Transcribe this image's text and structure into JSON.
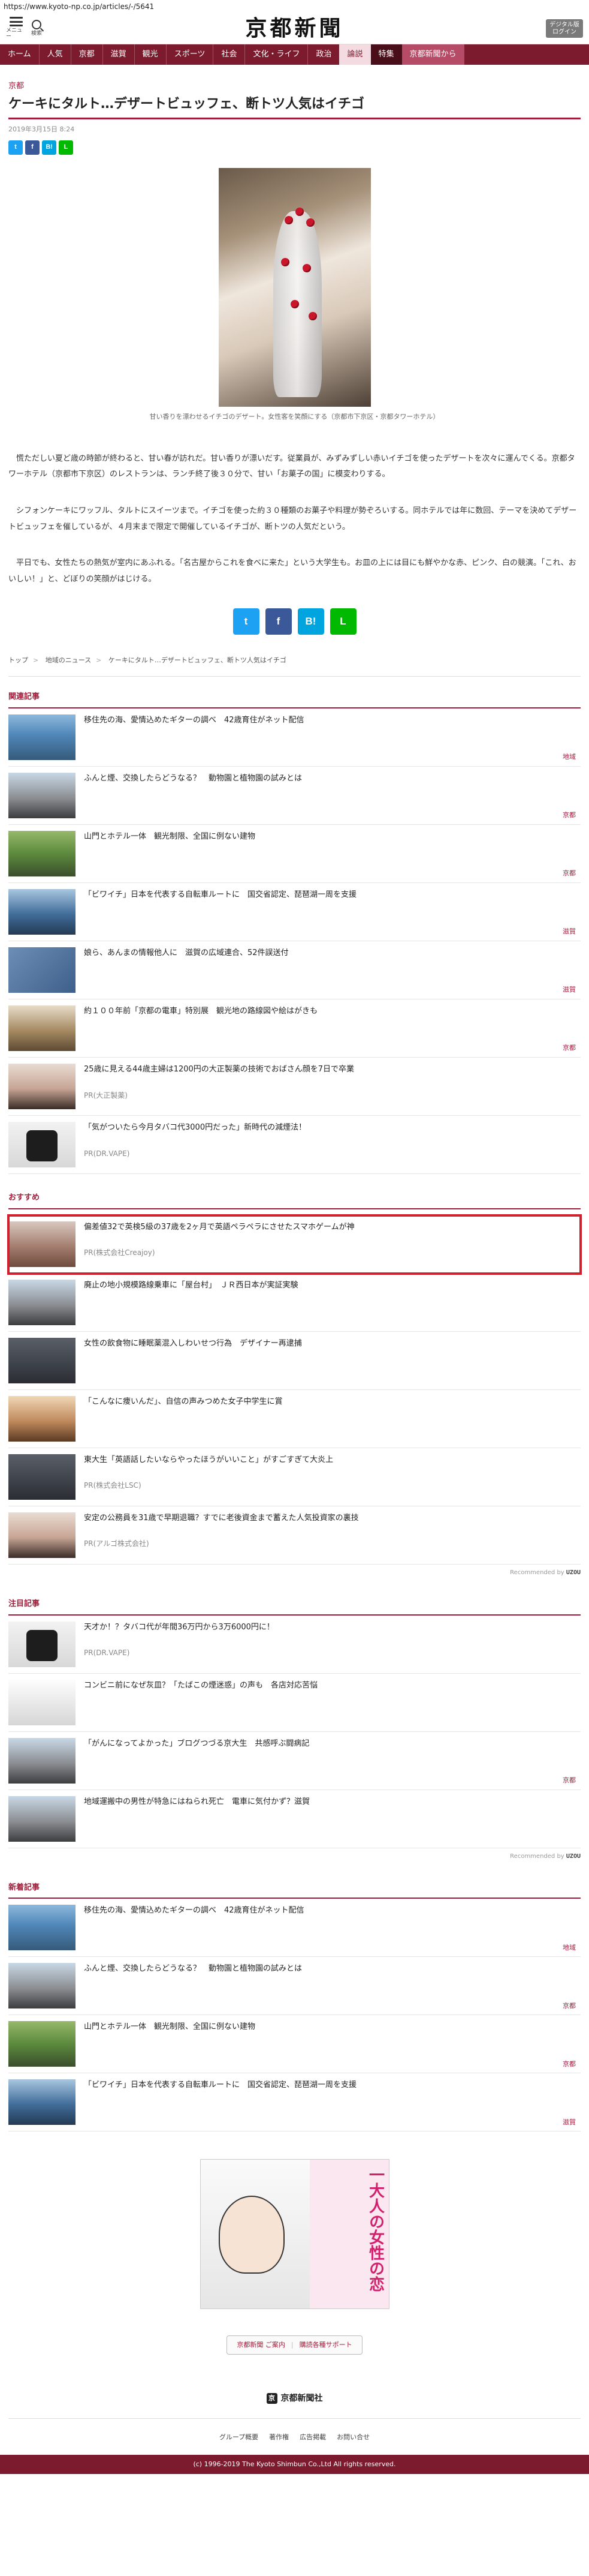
{
  "url": "https://www.kyoto-np.co.jp/articles/-/5641",
  "header": {
    "menu_label": "メニュー",
    "search_label": "検索",
    "logo": "京都新聞",
    "digital_btn": "デジタル版 ログイン"
  },
  "nav": [
    "ホーム",
    "人気",
    "京都",
    "滋賀",
    "観光",
    "スポーツ",
    "社会",
    "文化・ライフ",
    "政治",
    "論説",
    "特集",
    "京都新聞から"
  ],
  "article": {
    "category": "京都",
    "title": "ケーキにタルト…デザートビュッフェ、断トツ人気はイチゴ",
    "date": "2019年3月15日 8:24",
    "caption": "甘い香りを漂わせるイチゴのデザート。女性客を笑顔にする（京都市下京区・京都タワーホテル）",
    "paragraphs": [
      "慌ただしい夏ど歳の時節が終わると、甘い春が訪れだ。甘い香りが漂いだす。従業員が、みずみずしい赤いイチゴを使ったデザートを次々に運んでくる。京都タワーホテル（京都市下京区）のレストランは、ランチ終了後３０分で、甘い「お菓子の国」に模変わりする。",
      "シフォンケーキにワッフル、タルトにスイーツまで。イチゴを使った約３０種類のお菓子や料理が勢ぞろいする。同ホテルでは年に数回、テーマを決めてデザートビュッフェを催しているが、４月末まで限定で開催しているイチゴが、断トツの人気だという。",
      "平日でも、女性たちの熱気が室内にあふれる。「名古屋からこれを食べに来た」という大学生も。お皿の上には目にも鮮やかな赤、ピンク、白の競演。「これ、おいしい！」と、どぼりの笑顔がはじける。"
    ],
    "breadcrumbs": [
      "トップ",
      "地域のニュース",
      "ケーキにタルト…デザートビュッフェ、断トツ人気はイチゴ"
    ]
  },
  "share": {
    "twitter": "t",
    "facebook": "f",
    "hatena": "B!",
    "line": "L"
  },
  "related": {
    "heading": "関連記事",
    "items": [
      {
        "title": "移住先の海、愛情込めたギターの調べ　42歳育住がネット配信",
        "tag": "地域"
      },
      {
        "title": "ふんと煙、交換したらどうなる？　動物園と植物園の試みとは",
        "tag": "京都"
      },
      {
        "title": "山門とホテル一体　観光制限、全国に例ない建物",
        "tag": "京都"
      },
      {
        "title": "「ビワイチ」日本を代表する自転車ルートに　国交省認定、琵琶湖一周を支援",
        "tag": "滋賀"
      },
      {
        "title": "娘ら、あんまの情報他人に　滋賀の広域連合、52件誤送付",
        "tag": "滋賀"
      },
      {
        "title": "約１００年前「京都の電車」特別展　観光地の路線図や絵はがきも",
        "tag": "京都"
      },
      {
        "title": "25歳に見える44歳主婦は1200円の大正製薬の技術でおばさん顔を7日で卒業",
        "pr": "PR(大正製薬)"
      },
      {
        "title": "「気がついたら今月タバコ代3000円だった」新時代の減煙法！",
        "pr": "PR(DR.VAPE)"
      }
    ]
  },
  "recommend": {
    "heading": "おすすめ",
    "items": [
      {
        "title": "偏差値32で英検5級の37歳を2ヶ月で英語ペラペラにさせたスマホゲームが神",
        "pr": "PR(株式会社Creajoy)"
      },
      {
        "title": "廃止の地小規模路線乗車に「屋台村」　ＪＲ西日本が実証実験",
        "tag": ""
      },
      {
        "title": "女性の飲食物に睡眠薬混入しわいせつ行為　デザイナー再逮捕",
        "tag": ""
      },
      {
        "title": "「こんなに痩いんだ」、自信の声みつめた女子中学生に賞",
        "tag": ""
      },
      {
        "title": "東大生「英語話したいならやったほうがいいこと」がすごすぎて大炎上",
        "pr": "PR(株式会社LSC)"
      },
      {
        "title": "安定の公務員を31歳で早期退職？すでに老後資金まで蓄えた人気投資家の裏技",
        "pr": "PR(アルゴ株式会社)"
      }
    ],
    "recommended_by_prefix": "Recommended by",
    "recommended_by": "UZOU"
  },
  "attention": {
    "heading": "注目記事",
    "items": [
      {
        "title": "天才か！？タバコ代が年間36万円から3万6000円に！",
        "pr": "PR(DR.VAPE)"
      },
      {
        "title": "コンビニ前になぜ灰皿？「たばこの煙迷惑」の声も　各店対応苦悩",
        "tag": ""
      },
      {
        "title": "「がんになってよかった」ブログつづる京大生　共感呼ぶ闘病記",
        "tag": "京都"
      },
      {
        "title": "地域運搬中の男性が特急にはねられ死亡　電車に気付かず？滋賀",
        "tag": ""
      }
    ],
    "recommended_by_prefix": "Recommended by",
    "recommended_by": "UZOU"
  },
  "latest": {
    "heading": "新着記事",
    "items": [
      {
        "title": "移住先の海、愛情込めたギターの調べ　42歳育住がネット配信",
        "tag": "地域"
      },
      {
        "title": "ふんと煙、交換したらどうなる？　動物園と植物園の試みとは",
        "tag": "京都"
      },
      {
        "title": "山門とホテル一体　観光制限、全国に例ない建物",
        "tag": "京都"
      },
      {
        "title": "「ビワイチ」日本を代表する自転車ルートに　国交省認定、琵琶湖一周を支援",
        "tag": "滋賀"
      }
    ]
  },
  "ad": {
    "text": "一大人の女性の恋"
  },
  "footer_pill": {
    "left": "京都新聞 ご案内",
    "right": "購読各種サポート"
  },
  "footer": {
    "logo": "京都新聞社",
    "links": [
      "グループ概要",
      "著作権",
      "広告掲載",
      "お問い合せ"
    ],
    "copyright": "(c) 1996-2019 The Kyoto Shimbun Co.,Ltd All rights reserved."
  }
}
